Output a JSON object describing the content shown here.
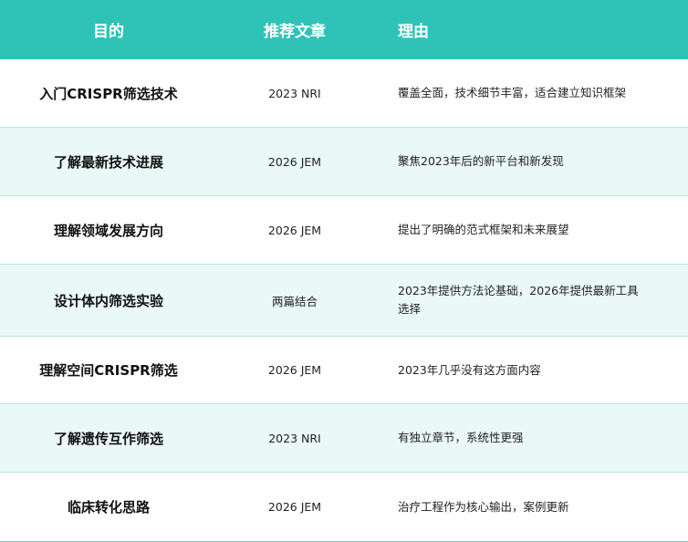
{
  "header": {
    "goal": "目的",
    "article": "推荐文章",
    "reason": "理由"
  },
  "rows": [
    {
      "goal": "入门CRISPR筛选技术",
      "article": "2023 NRI",
      "reason": "覆盖全面，技术细节丰富，适合建立知识框架"
    },
    {
      "goal": "了解最新技术进展",
      "article": "2026 JEM",
      "reason": "聚焦2023年后的新平台和新发现"
    },
    {
      "goal": "理解领域发展方向",
      "article": "2026 JEM",
      "reason": "提出了明确的范式框架和未来展望"
    },
    {
      "goal": "设计体内筛选实验",
      "article": "两篇结合",
      "reason": "2023年提供方法论基础，2026年提供最新工具选择"
    },
    {
      "goal": "理解空间CRISPR筛选",
      "article": "2026 JEM",
      "reason": "2023年几乎没有这方面内容"
    },
    {
      "goal": "了解遗传互作筛选",
      "article": "2023 NRI",
      "reason": "有独立章节，系统性更强"
    },
    {
      "goal": "临床转化思路",
      "article": "2026 JEM",
      "reason": "治疗工程作为核心输出，案例更新"
    }
  ],
  "colors": {
    "header_bg": "#2fc3b7",
    "alt_row_bg": "#eaf8f6",
    "border": "#b9e6e1"
  }
}
